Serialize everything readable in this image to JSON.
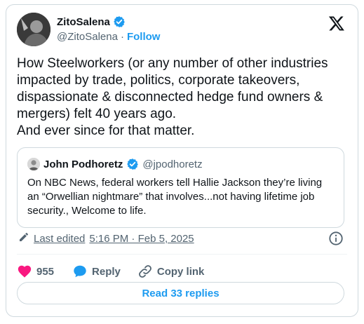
{
  "author": {
    "name": "ZitoSalena",
    "handle": "@ZitoSalena",
    "separator": "·",
    "follow_label": "Follow"
  },
  "tweet": {
    "lines": [
      "How Steelworkers (or any number of other industries impacted by trade, politics, corporate takeovers, dispassionate & disconnected hedge fund owners & mergers) felt 40 years ago.",
      "And ever since for that matter."
    ]
  },
  "quote": {
    "name": "John Podhoretz",
    "handle": "@jpodhoretz",
    "text": "On NBC News, federal workers tell Hallie Jackson they’re living an “Orwellian nightmare” that involves...not having lifetime job security., Welcome to life."
  },
  "meta": {
    "edited_label": "Last edited",
    "timestamp": "5:16 PM · Feb 5, 2025"
  },
  "actions": {
    "likes": "955",
    "reply_label": "Reply",
    "copy_link_label": "Copy link"
  },
  "read_replies_label": "Read 33 replies",
  "icons": {
    "verified": "verified-badge-icon",
    "x_logo": "x-logo-icon",
    "like": "heart-icon",
    "reply": "reply-bubble-icon",
    "copy": "link-icon",
    "info": "info-icon",
    "edit": "pencil-icon"
  },
  "colors": {
    "accent": "#1d9bf0",
    "like": "#f91880",
    "text": "#0f1419",
    "muted": "#536471",
    "border": "#cfd9de"
  }
}
